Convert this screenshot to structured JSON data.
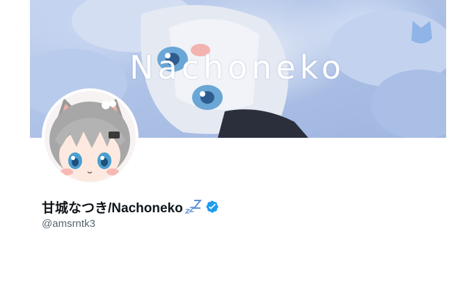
{
  "profile": {
    "banner_text": "Nachoneko",
    "display_name": "甘城なつき/Nachoneko",
    "handle": "@amsrntk3"
  },
  "icons": {
    "sleep": "zzz-icon",
    "verified": "verified-badge-icon"
  },
  "colors": {
    "verified": "#1d9bf0",
    "zzz": "#5b8fd6",
    "handle": "#536471"
  }
}
